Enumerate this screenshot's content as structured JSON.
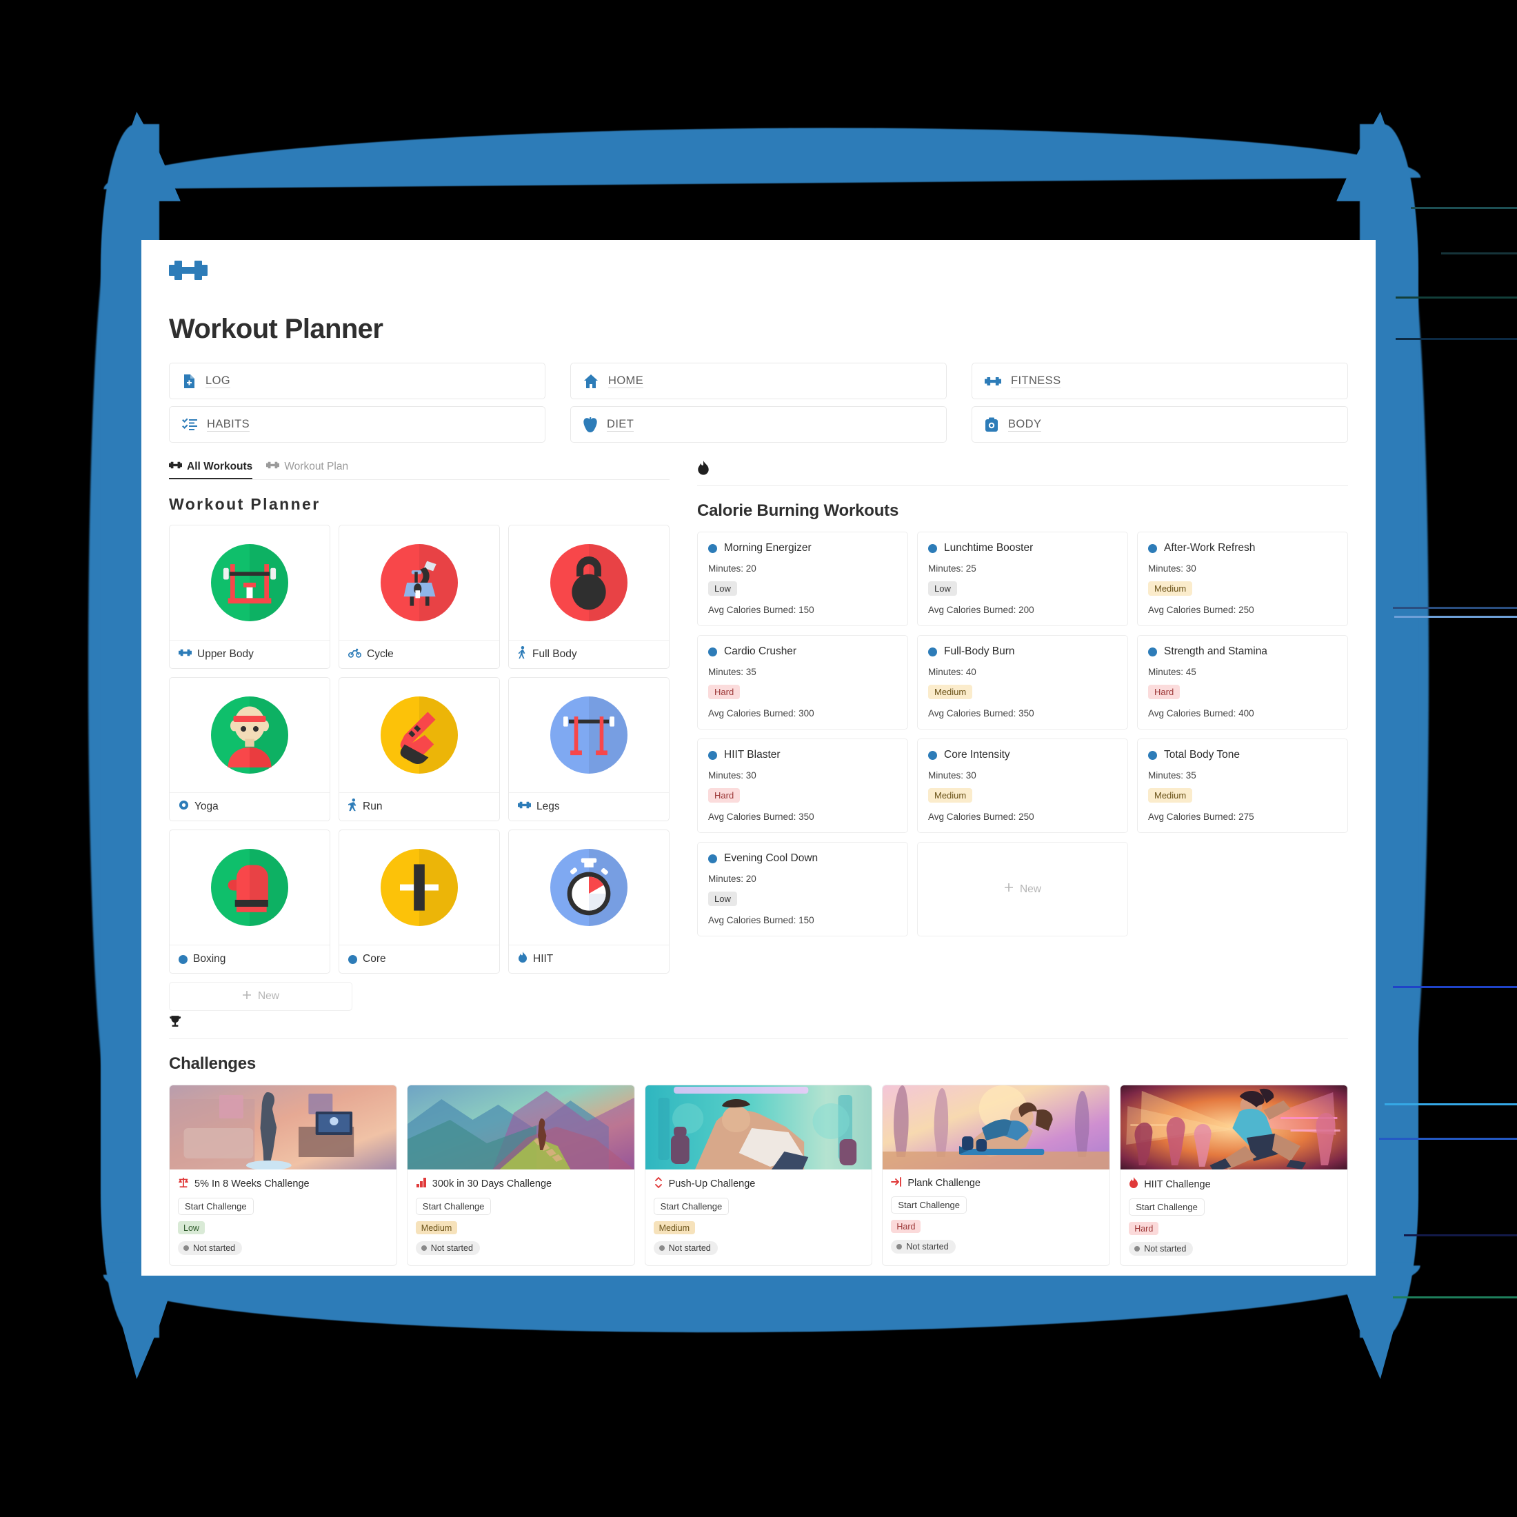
{
  "app": {
    "logo_icon": "dumbbell-icon",
    "title": "Workout Planner",
    "accent_color": "#2d7cb8",
    "frame_color": "#2d7cb8"
  },
  "nav": {
    "buttons": [
      {
        "label": "LOG",
        "icon": "document-add-icon"
      },
      {
        "label": "HOME",
        "icon": "home-icon"
      },
      {
        "label": "FITNESS",
        "icon": "dumbbell-icon"
      },
      {
        "label": "HABITS",
        "icon": "checklist-icon"
      },
      {
        "label": "DIET",
        "icon": "apple-icon"
      },
      {
        "label": "BODY",
        "icon": "camera-icon"
      }
    ]
  },
  "workouts_panel": {
    "tabs": [
      {
        "label": "All Workouts",
        "icon": "dumbbell-icon",
        "active": true
      },
      {
        "label": "Workout Plan",
        "icon": "dumbbell-icon",
        "active": false
      }
    ],
    "heading": "Workout Planner",
    "new_label": "New",
    "items": [
      {
        "label": "Upper Body",
        "icon": "dumbbell-icon",
        "thumb": "bench-press",
        "bg": "#0fbf6b"
      },
      {
        "label": "Cycle",
        "icon": "bicycle-icon",
        "thumb": "exercise-bike",
        "bg": "#f8474a"
      },
      {
        "label": "Full Body",
        "icon": "person-walk-icon",
        "thumb": "kettlebell",
        "bg": "#f8474a"
      },
      {
        "label": "Yoga",
        "icon": "circle-ring-icon",
        "thumb": "person-head",
        "bg": "#0fbf6b"
      },
      {
        "label": "Run",
        "icon": "runner-icon",
        "thumb": "sneaker",
        "bg": "#fcc209"
      },
      {
        "label": "Legs",
        "icon": "dumbbell-icon",
        "thumb": "squat-rack",
        "bg": "#7fa9f2"
      },
      {
        "label": "Boxing",
        "icon": "blue-dot-icon",
        "thumb": "boxing-glove",
        "bg": "#0fbf6b"
      },
      {
        "label": "Core",
        "icon": "blue-dot-icon",
        "thumb": "weight-plate",
        "bg": "#fcc209"
      },
      {
        "label": "HIIT",
        "icon": "flame-icon",
        "thumb": "stopwatch",
        "bg": "#7fa9f2"
      }
    ]
  },
  "calorie_panel": {
    "rule_icon": "flame-icon",
    "heading": "Calorie Burning Workouts",
    "minutes_prefix": "Minutes: ",
    "calories_prefix": "Avg Calories Burned: ",
    "new_label": "New",
    "cards": [
      {
        "name": "Morning Energizer",
        "minutes": "Minutes: 20",
        "difficulty": "Low",
        "calories": "Avg Calories Burned: 150"
      },
      {
        "name": "Lunchtime Booster",
        "minutes": "Minutes: 25",
        "difficulty": "Low",
        "calories": "Avg Calories Burned: 200"
      },
      {
        "name": "After-Work Refresh",
        "minutes": "Minutes: 30",
        "difficulty": "Medium",
        "calories": "Avg Calories Burned: 250"
      },
      {
        "name": "Cardio Crusher",
        "minutes": "Minutes: 35",
        "difficulty": "Hard",
        "calories": "Avg Calories Burned: 300"
      },
      {
        "name": "Full-Body Burn",
        "minutes": "Minutes: 40",
        "difficulty": "Medium",
        "calories": "Avg Calories Burned: 350"
      },
      {
        "name": "Strength and Stamina",
        "minutes": "Minutes: 45",
        "difficulty": "Hard",
        "calories": "Avg Calories Burned: 400"
      },
      {
        "name": "HIIT Blaster",
        "minutes": "Minutes: 30",
        "difficulty": "Hard",
        "calories": "Avg Calories Burned: 350"
      },
      {
        "name": "Core Intensity",
        "minutes": "Minutes: 30",
        "difficulty": "Medium",
        "calories": "Avg Calories Burned: 250"
      },
      {
        "name": "Total Body Tone",
        "minutes": "Minutes: 35",
        "difficulty": "Medium",
        "calories": "Avg Calories Burned: 275"
      },
      {
        "name": "Evening Cool Down",
        "minutes": "Minutes: 20",
        "difficulty": "Low",
        "calories": "Avg Calories Burned: 150"
      }
    ]
  },
  "challenges_panel": {
    "rule_icon": "trophy-icon",
    "heading": "Challenges",
    "cards": [
      {
        "title": "5% In 8 Weeks Challenge",
        "icon": "scale-icon",
        "action": "Start Challenge",
        "difficulty": "Low",
        "status": "Not started",
        "scene": "bedroom-scale"
      },
      {
        "title": "300k in 30 Days Challenge",
        "icon": "bar-chart-icon",
        "action": "Start Challenge",
        "difficulty": "Medium",
        "status": "Not started",
        "scene": "mountain-stairs"
      },
      {
        "title": "Push-Up Challenge",
        "icon": "updown-arrow-icon",
        "action": "Start Challenge",
        "difficulty": "Medium",
        "status": "Not started",
        "scene": "pushup-gym"
      },
      {
        "title": "Plank Challenge",
        "icon": "arrow-bar-icon",
        "action": "Start Challenge",
        "difficulty": "Hard",
        "status": "Not started",
        "scene": "plank-park"
      },
      {
        "title": "HIIT Challenge",
        "icon": "flame-icon",
        "action": "Start Challenge",
        "difficulty": "Hard",
        "status": "Not started",
        "scene": "runner-neon"
      }
    ]
  }
}
